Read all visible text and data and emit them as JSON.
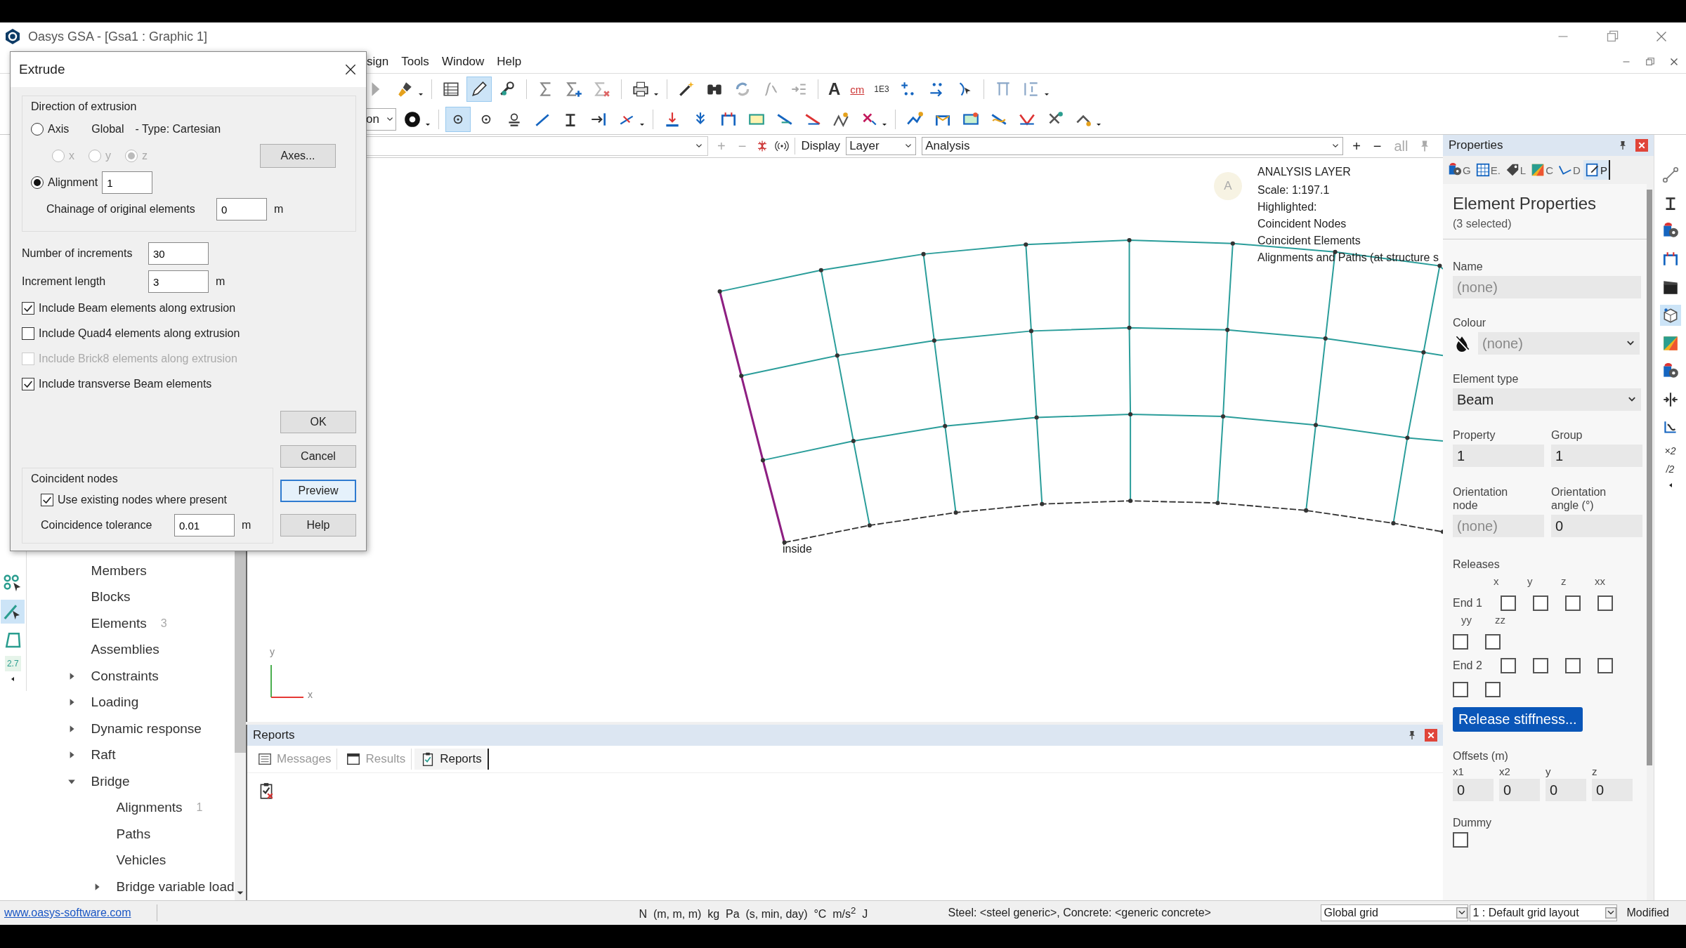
{
  "window": {
    "title": "Oasys GSA - [Gsa1 : Graphic 1]"
  },
  "menu": [
    "sign",
    "Tools",
    "Window",
    "Help"
  ],
  "toolbar_1": {
    "texts": [
      "A",
      "cm",
      "1E3"
    ]
  },
  "toolbar_2": {
    "mode_select": "on"
  },
  "graphic_toolbar": {
    "zoom_in": "+",
    "zoom_out": "−",
    "display_label": "Display",
    "display_select": "Layer",
    "layer_select": "Analysis",
    "add": "+",
    "remove": "−",
    "all": "all"
  },
  "graphic": {
    "badge": "A",
    "info": [
      "ANALYSIS LAYER",
      "Scale: 1:197.1",
      "Highlighted:",
      "Coincident Nodes",
      "Coincident Elements",
      "Alignments and Paths (at structure s"
    ],
    "label": "inside",
    "axis_y": "y",
    "axis_x": "x"
  },
  "left_toolstrip": {
    "value": "2.7"
  },
  "tree": [
    {
      "label": "Members"
    },
    {
      "label": "Blocks"
    },
    {
      "label": "Elements",
      "count": "3"
    },
    {
      "label": "Assemblies"
    },
    {
      "label": "Constraints",
      "expanded": false
    },
    {
      "label": "Loading",
      "expanded": false
    },
    {
      "label": "Dynamic response",
      "expanded": false
    },
    {
      "label": "Raft",
      "expanded": false
    },
    {
      "label": "Bridge",
      "expanded": true,
      "children": [
        {
          "label": "Alignments",
          "count": "1"
        },
        {
          "label": "Paths"
        },
        {
          "label": "Vehicles"
        },
        {
          "label": "Bridge variable load",
          "expanded": false
        }
      ]
    }
  ],
  "dialog": {
    "title": "Extrude",
    "direction": {
      "title": "Direction of extrusion",
      "axis_radio": {
        "label": "Axis",
        "selected": false
      },
      "axis_system": "Global",
      "axis_type": "- Type: Cartesian",
      "axis_choices": [
        {
          "label": "x",
          "selected": false,
          "disabled": true
        },
        {
          "label": "y",
          "selected": false,
          "disabled": true
        },
        {
          "label": "z",
          "selected": true,
          "disabled": true
        }
      ],
      "axes_button": "Axes...",
      "alignment_radio": {
        "label": "Alignment",
        "selected": true
      },
      "alignment_value": "1",
      "chainage": {
        "label": "Chainage of original elements",
        "value": "0",
        "unit": "m"
      }
    },
    "increments": {
      "label": "Number of increments",
      "value": "30"
    },
    "increment_length": {
      "label": "Increment length",
      "value": "3",
      "unit": "m"
    },
    "options": [
      {
        "label": "Include Beam elements along extrusion",
        "checked": true,
        "disabled": false
      },
      {
        "label": "Include Quad4 elements along extrusion",
        "checked": false,
        "disabled": false
      },
      {
        "label": "Include Brick8 elements along extrusion",
        "checked": false,
        "disabled": true
      },
      {
        "label": "Include transverse Beam elements",
        "checked": true,
        "disabled": false
      }
    ],
    "coincident": {
      "title": "Coincident nodes",
      "use_existing": {
        "label": "Use existing nodes where present",
        "checked": true
      },
      "tolerance": {
        "label": "Coincidence tolerance",
        "value": "0.01",
        "unit": "m"
      }
    },
    "buttons": [
      {
        "label": "OK",
        "focused": false
      },
      {
        "label": "Cancel",
        "focused": false
      },
      {
        "label": "Preview",
        "focused": true
      },
      {
        "label": "Help",
        "focused": false
      }
    ]
  },
  "reports": {
    "title": "Reports",
    "tabs": [
      {
        "label": "Messages",
        "selected": false
      },
      {
        "label": "Results",
        "selected": false
      },
      {
        "label": "Reports",
        "selected": true
      }
    ]
  },
  "properties": {
    "title": "Properties",
    "tabs": [
      {
        "label": "G",
        "selected": false
      },
      {
        "label": "E.",
        "selected": false
      },
      {
        "label": "L",
        "selected": false
      },
      {
        "label": "C",
        "selected": false
      },
      {
        "label": "D",
        "selected": false
      },
      {
        "label": "P",
        "selected": true
      }
    ],
    "heading": "Element Properties",
    "subheading": "(3 selected)",
    "name": {
      "label": "Name",
      "placeholder": "(none)"
    },
    "colour": {
      "label": "Colour",
      "placeholder": "(none)"
    },
    "element_type": {
      "label": "Element type",
      "value": "Beam"
    },
    "property": {
      "label": "Property",
      "value": "1"
    },
    "group": {
      "label": "Group",
      "value": "1"
    },
    "orientation_node": {
      "label": "Orientation node",
      "placeholder": "(none)"
    },
    "orientation_angle": {
      "label": "Orientation angle (°)",
      "value": "0"
    },
    "releases": {
      "label": "Releases",
      "columns": [
        "x",
        "y",
        "z",
        "xx"
      ],
      "columns_2": [
        "yy",
        "zz"
      ],
      "ends": [
        {
          "label": "End 1",
          "checks": [
            false,
            false,
            false,
            false,
            false,
            false
          ]
        },
        {
          "label": "End 2",
          "checks": [
            false,
            false,
            false,
            false,
            false,
            false
          ]
        }
      ]
    },
    "release_button": "Release stiffness...",
    "offsets": {
      "label": "Offsets (m)",
      "fields": [
        {
          "label": "x1",
          "value": "0"
        },
        {
          "label": "x2",
          "value": "0"
        },
        {
          "label": "y",
          "value": "0"
        },
        {
          "label": "z",
          "value": "0"
        }
      ]
    },
    "dummy": {
      "label": "Dummy",
      "checked": false
    }
  },
  "right_toolstrip": [
    "×2",
    "/2"
  ],
  "status_bar": {
    "link": "www.oasys-software.com",
    "units": "N  (m, m, m)  kg  Pa  (s, min, day)  °C  m/s$^{2}$  J",
    "materials": "Steel: <steel generic>, Concrete: <generic concrete>",
    "grid": "Global grid",
    "layout": "1 : Default grid layout",
    "state": "Modified"
  }
}
